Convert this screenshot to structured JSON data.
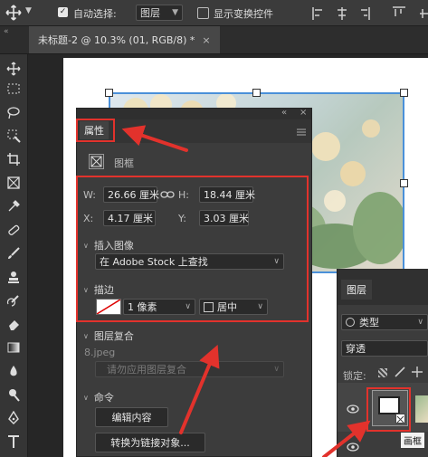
{
  "options_bar": {
    "auto_select_label": "自动选择:",
    "auto_select_value": "图层",
    "show_transform_label": "显示变换控件"
  },
  "document_tab": {
    "title": "未标题-2 @ 10.3% (01, RGB/8) *",
    "close": "×"
  },
  "properties_panel": {
    "title": "属性",
    "collapse": "«",
    "close": "×",
    "kind_label": "图框",
    "w_label": "W:",
    "w_value": "26.66 厘米",
    "h_label": "H:",
    "h_value": "18.44 厘米",
    "x_label": "X:",
    "x_value": "4.17 厘米",
    "y_label": "Y:",
    "y_value": "3.03 厘米",
    "insert_image_label": "插入图像",
    "insert_image_option": "在 Adobe Stock 上查找",
    "stroke_label": "描边",
    "stroke_width": "1 像素",
    "stroke_align": "居中",
    "comps_label": "图层复合",
    "comps_file": "8.jpeg",
    "comps_apply": "请勿应用图层复合",
    "commands_label": "命令",
    "edit_contents": "编辑内容",
    "convert_linked": "转换为链接对象..."
  },
  "layers_panel": {
    "title": "图层",
    "kind_filter": "类型",
    "blend_mode": "穿透",
    "lock_label": "锁定:",
    "tooltip": "画框"
  },
  "colors": {
    "highlight_red": "#e2322c",
    "panel_bg": "#3c3c3c",
    "selection_blue": "#4a90d9"
  }
}
